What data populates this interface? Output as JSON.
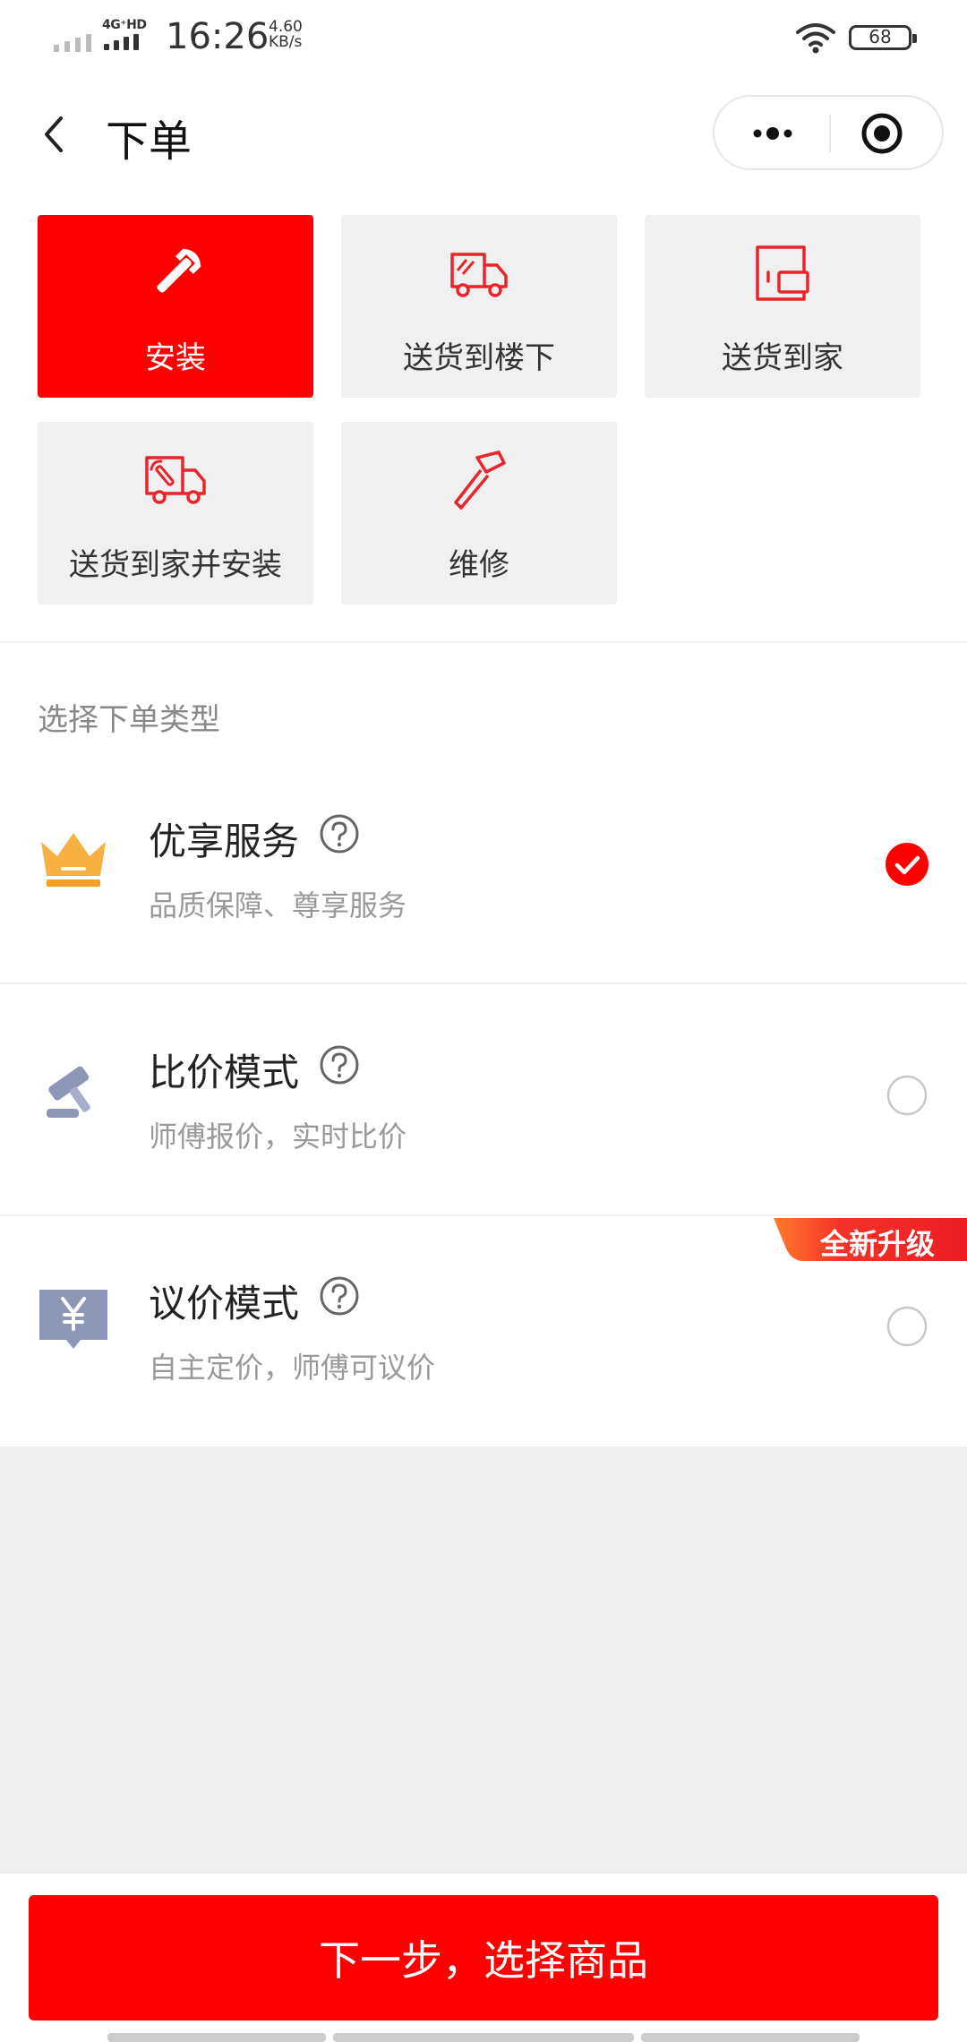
{
  "status_bar": {
    "network": "4G⁺HD",
    "time": "16:26",
    "speed_value": "4.60",
    "speed_unit": "KB/s",
    "battery": "68"
  },
  "nav": {
    "title": "下单"
  },
  "services": [
    {
      "label": "安装",
      "icon": "wrench-icon",
      "selected": true
    },
    {
      "label": "送货到楼下",
      "icon": "delivery-truck-icon",
      "selected": false
    },
    {
      "label": "送货到家",
      "icon": "home-delivery-icon",
      "selected": false
    },
    {
      "label": "送货到家并安装",
      "icon": "truck-install-icon",
      "selected": false
    },
    {
      "label": "维修",
      "icon": "hammer-icon",
      "selected": false
    }
  ],
  "section_title": "选择下单类型",
  "order_types": [
    {
      "name": "优享服务",
      "desc": "品质保障、尊享服务",
      "icon": "crown-icon",
      "selected": true
    },
    {
      "name": "比价模式",
      "desc": "师傅报价，实时比价",
      "icon": "gavel-icon",
      "selected": false
    },
    {
      "name": "议价模式",
      "desc": "自主定价，师傅可议价",
      "icon": "yuan-tag-icon",
      "selected": false,
      "badge": "全新升级"
    }
  ],
  "footer": {
    "next_label": "下一步，选择商品"
  },
  "colors": {
    "accent": "#ff0000",
    "tile_bg": "#f0f0f0",
    "crown": "#f7b042",
    "muted_icon": "#8e96b8"
  }
}
